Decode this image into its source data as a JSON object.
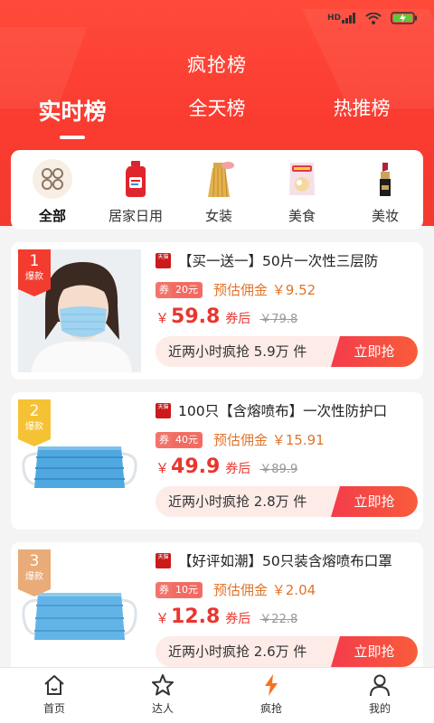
{
  "status_bar": {
    "signal_label": "HD",
    "battery_icon": "battery-charging-icon"
  },
  "header": {
    "title": "疯抢榜"
  },
  "tabs": [
    {
      "label": "实时榜",
      "active": true
    },
    {
      "label": "全天榜",
      "active": false
    },
    {
      "label": "热推榜",
      "active": false
    }
  ],
  "categories": [
    {
      "label": "全部",
      "icon": "grid-icon",
      "active": true
    },
    {
      "label": "居家日用",
      "icon": "detergent-bottle-icon",
      "active": false
    },
    {
      "label": "女装",
      "icon": "skirt-icon",
      "active": false
    },
    {
      "label": "美食",
      "icon": "snack-bag-icon",
      "active": false
    },
    {
      "label": "美妆",
      "icon": "lipstick-icon",
      "active": false
    }
  ],
  "products": [
    {
      "rank": "1",
      "rank_tag": "爆款",
      "store_badge": "天猫",
      "title": "【买一送一】50片一次性三层防",
      "coupon_label": "券",
      "coupon_value": "20元",
      "commission": "预估佣金 ￥9.52",
      "price_symbol": "￥",
      "price": "59.8",
      "after_label": "券后",
      "original_price": "￥79.8",
      "sales": "近两小时疯抢 5.9万 件",
      "buy_label": "立即抢"
    },
    {
      "rank": "2",
      "rank_tag": "爆款",
      "store_badge": "天猫",
      "title": "100只【含熔喷布】一次性防护口",
      "coupon_label": "券",
      "coupon_value": "40元",
      "commission": "预估佣金 ￥15.91",
      "price_symbol": "￥",
      "price": "49.9",
      "after_label": "券后",
      "original_price": "￥89.9",
      "sales": "近两小时疯抢 2.8万 件",
      "buy_label": "立即抢"
    },
    {
      "rank": "3",
      "rank_tag": "爆款",
      "store_badge": "天猫",
      "title": "【好评如潮】50只装含熔喷布口罩",
      "coupon_label": "券",
      "coupon_value": "10元",
      "commission": "预估佣金 ￥2.04",
      "price_symbol": "￥",
      "price": "12.8",
      "after_label": "券后",
      "original_price": "￥22.8",
      "sales": "近两小时疯抢 2.6万 件",
      "buy_label": "立即抢"
    }
  ],
  "bottom_nav": [
    {
      "label": "首页",
      "icon": "home-icon",
      "active": false
    },
    {
      "label": "达人",
      "icon": "star-icon",
      "active": false
    },
    {
      "label": "疯抢",
      "icon": "lightning-icon",
      "active": true
    },
    {
      "label": "我的",
      "icon": "user-icon",
      "active": false
    }
  ],
  "colors": {
    "header_red": "#fa3b30",
    "price_red": "#e8362f",
    "commission_orange": "#e0742c",
    "active_nav": "#f5731e"
  }
}
